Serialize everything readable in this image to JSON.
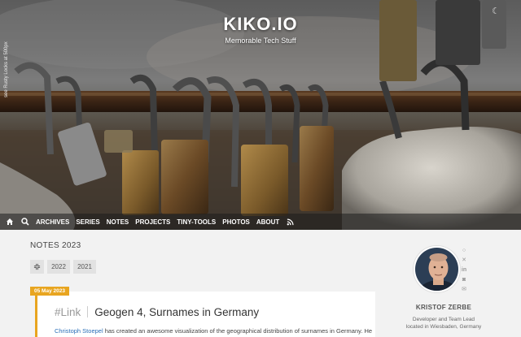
{
  "site": {
    "title": "KIKO.IO",
    "tagline": "Memorable Tech Stuff",
    "photo_credit": "see Rusty Locks at 500px"
  },
  "nav": {
    "items": [
      {
        "label": "ARCHIVES"
      },
      {
        "label": "SERIES"
      },
      {
        "label": "NOTES"
      },
      {
        "label": "PROJECTS"
      },
      {
        "label": "TINY-TOOLS"
      },
      {
        "label": "PHOTOS"
      },
      {
        "label": "ABOUT"
      }
    ]
  },
  "page": {
    "heading": "NOTES 2023",
    "filters": [
      "2022",
      "2021"
    ]
  },
  "post": {
    "date": "05 May 2023",
    "tag": "#Link",
    "title": "Geogen 4, Surnames in Germany",
    "excerpt_link": "Christoph Stoepel",
    "excerpt_rest": " has created an awesome visualization of the geographical distribution of surnames in Germany. He"
  },
  "author": {
    "name": "KRISTOF ZERBE",
    "bio_line1": "Developer and Team Lead",
    "bio_line2": "located in Wiesbaden, Germany"
  },
  "colors": {
    "accent": "#e8a520",
    "link": "#2a6fb8"
  },
  "icons": [
    "home-icon",
    "search-icon",
    "rss-icon",
    "moon-icon",
    "expand-icon",
    "github-icon",
    "x-twitter-icon",
    "linkedin-icon",
    "mastodon-icon",
    "email-icon"
  ]
}
